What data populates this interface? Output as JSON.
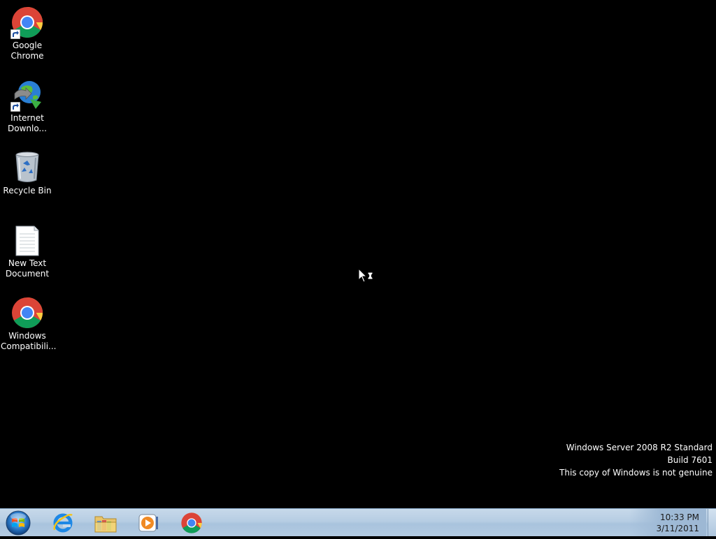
{
  "desktop": {
    "icons": [
      {
        "label": "Google\nChrome",
        "icon": "chrome-icon",
        "shortcut": true
      },
      {
        "label": "Internet\nDownlo...",
        "icon": "internet-download-manager-icon",
        "shortcut": true
      },
      {
        "label": "Recycle Bin",
        "icon": "recycle-bin-icon",
        "shortcut": false
      },
      {
        "label": "New Text\nDocument",
        "icon": "text-document-icon",
        "shortcut": false
      },
      {
        "label": "Windows\nCompatibili...",
        "icon": "chrome-icon",
        "shortcut": false
      }
    ],
    "watermark": {
      "line1": "Windows Server 2008 R2 Standard",
      "line2": "Build 7601",
      "line3": "This copy of Windows is not genuine"
    },
    "cursor": "busy-cursor-icon"
  },
  "taskbar": {
    "start_icon": "windows-start-orb-icon",
    "pinned": [
      {
        "name": "internet-explorer",
        "icon": "internet-explorer-icon"
      },
      {
        "name": "windows-explorer",
        "icon": "folder-library-icon"
      },
      {
        "name": "windows-media-player",
        "icon": "media-player-icon"
      },
      {
        "name": "google-chrome",
        "icon": "chrome-icon"
      }
    ],
    "clock": {
      "time": "10:33 PM",
      "date": "3/11/2011"
    }
  },
  "colors": {
    "desktop_bg": "#000000",
    "taskbar_top": "#c7d9ea",
    "taskbar_bottom": "#b3cbe2",
    "text_white": "#ffffff"
  }
}
